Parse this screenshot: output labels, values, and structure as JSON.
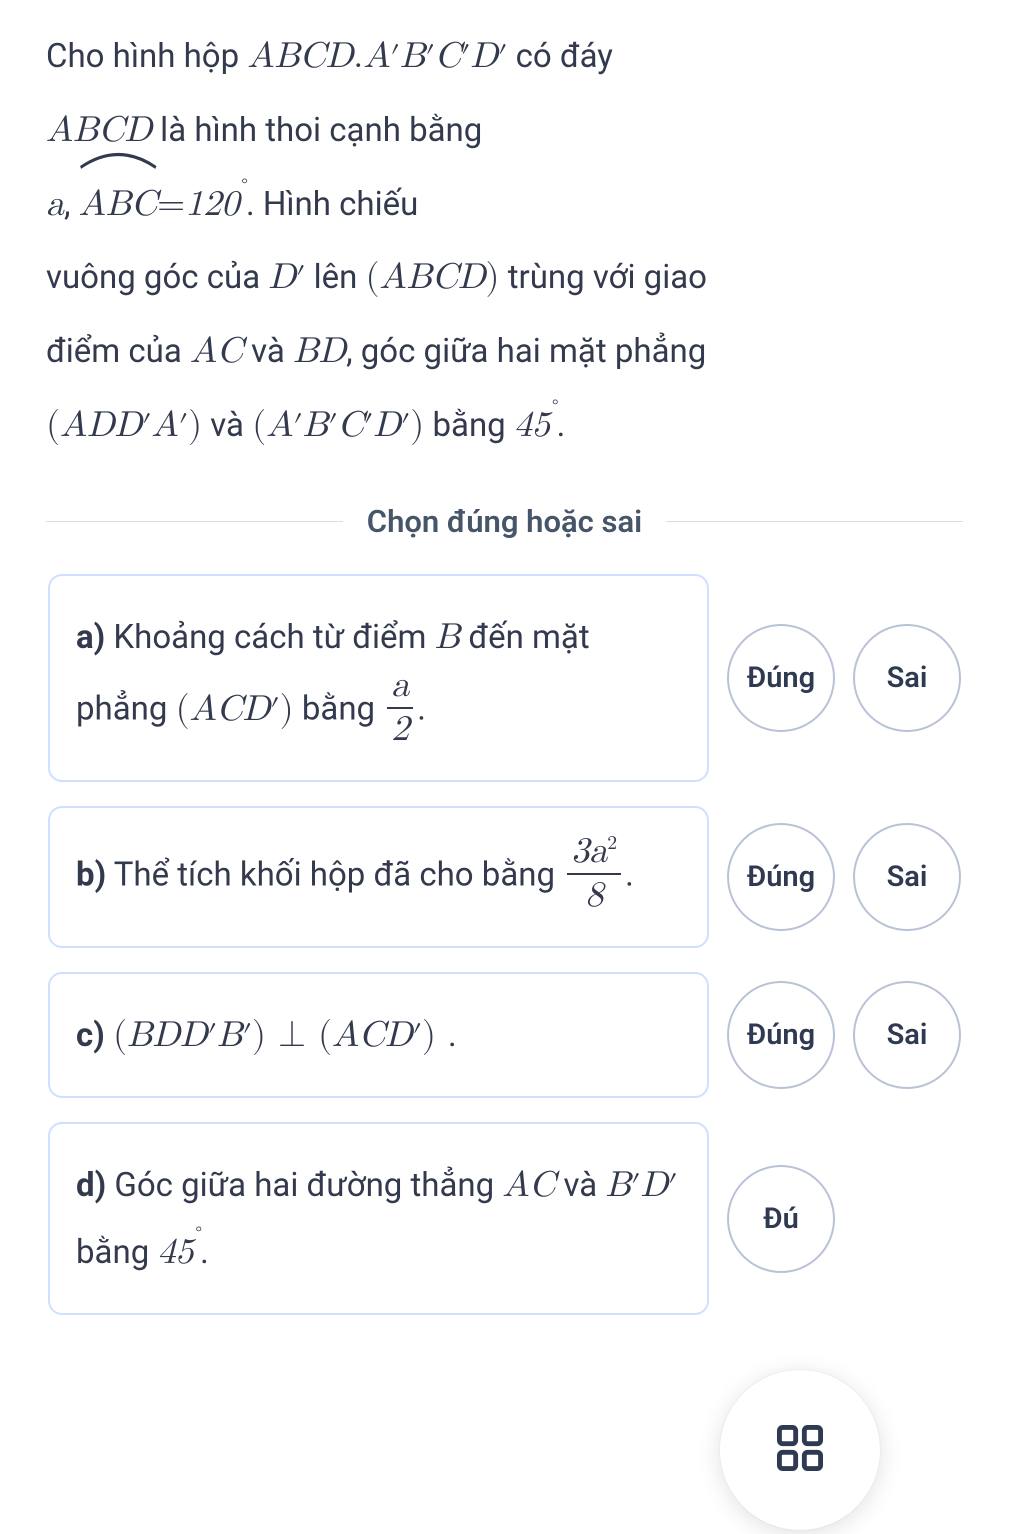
{
  "problem": {
    "p1_a": "Cho hình hộp ",
    "p1_m1": "ABCD.A′B′C′D′",
    "p1_b": " có đáy ",
    "p2_m1": "ABCD",
    "p2_a": " là hình thoi cạnh bằng ",
    "p3_m1": "a",
    "p3_comma": ", ",
    "p3_hat": "ABC",
    "p3_eq": "=120",
    "p3_b": ". Hình chiếu ",
    "p4_a": "vuông góc của ",
    "p4_m1": "D′",
    "p4_b": " lên ",
    "p4_m2": "(ABCD)",
    "p4_c": " trùng với giao ",
    "p5_a": "điểm của ",
    "p5_m1": "AC",
    "p5_b": " và ",
    "p5_m2": "BD",
    "p5_c": ", góc giữa hai mặt phẳng ",
    "p6_m1": "(ADD′A′)",
    "p6_a": " và ",
    "p6_m2": "(A′B′C′D′)",
    "p6_b": " bằng ",
    "p6_m3": "45",
    "p6_c": "."
  },
  "divider": "Chọn đúng hoặc sai",
  "buttons": {
    "true": "Đúng",
    "false": "Sai",
    "true_cut": "Đú"
  },
  "options": {
    "a": {
      "label": "a)",
      "t1": " Khoảng cách từ điểm ",
      "m1": "B",
      "t2": " đến mặt phẳng ",
      "m2": "(ACD′)",
      "t3": " bằng ",
      "frac_num": "a",
      "frac_den": "2",
      "t4": "."
    },
    "b": {
      "label": "b)",
      "t1": " Thể tích khối hộp đã cho bằng ",
      "frac_num": "3a²",
      "frac_den": "8",
      "t2": "."
    },
    "c": {
      "label": "c)",
      "m1": "(BDD′B′)",
      "perp": "⊥",
      "m2": "(ACD′)",
      "t1": "."
    },
    "d": {
      "label": "d)",
      "t1": " Góc giữa hai đường thẳng ",
      "m1": "AC",
      "t2": " và ",
      "m2": "B′D′",
      "t3": " bằng ",
      "m3": "45",
      "t4": "."
    }
  }
}
